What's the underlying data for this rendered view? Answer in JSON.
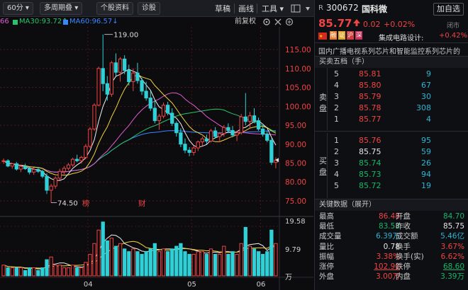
{
  "toolbar": {
    "period_select": "60分",
    "period_arrow": "▾",
    "multi_period": "多周期叠",
    "multi_period_arrow": "▾",
    "profile_button": "个股资料",
    "diagnose_button": "诊股",
    "draft_button": "草稿",
    "draw_button": "画线",
    "tools_button": "工具",
    "tools_arrow": "▾",
    "add_button": "加自选"
  },
  "ma_row": {
    "ma20": "66",
    "ma30": "MA30:93.72↑",
    "ma60": "MA60:96.57↓",
    "adjust_label": "前复权"
  },
  "stock": {
    "r_badge": "R",
    "code": "300672",
    "name": "国科微",
    "price": "85.77",
    "change": "0.02",
    "change_pct": "+0.02%",
    "sector_name": "集成电路设计:",
    "sector_pct": "+0.42%",
    "status": "闭市",
    "description": "国内广播电视系列芯片和智能监控系列芯片的",
    "badges": [
      "融",
      "证",
      "沪",
      "深"
    ]
  },
  "orderbook": {
    "title": "买卖五档（手）",
    "sell_label_1": "卖",
    "sell_label_2": "盘",
    "buy_label_1": "买",
    "buy_label_2": "盘",
    "asks": [
      {
        "level": "5",
        "price": "85.81",
        "vol": "9"
      },
      {
        "level": "4",
        "price": "85.80",
        "vol": "67"
      },
      {
        "level": "3",
        "price": "85.79",
        "vol": "30"
      },
      {
        "level": "2",
        "price": "85.78",
        "vol": "308"
      },
      {
        "level": "1",
        "price": "85.77",
        "vol": "4"
      }
    ],
    "bids": [
      {
        "level": "1",
        "price": "85.76",
        "vol": "95"
      },
      {
        "level": "2",
        "price": "85.75",
        "vol": "59"
      },
      {
        "level": "3",
        "price": "85.74",
        "vol": "26"
      },
      {
        "level": "4",
        "price": "85.73",
        "vol": "94"
      },
      {
        "level": "5",
        "price": "85.72",
        "vol": "19"
      }
    ]
  },
  "keydata": {
    "title": "关键数据（展开）",
    "rows": [
      {
        "k1": "最高",
        "v1": "86.48",
        "k2": "开盘",
        "v2": "84.70"
      },
      {
        "k1": "最低",
        "v1": "83.58",
        "k2": "昨收",
        "v2": "85.75"
      },
      {
        "k1": "成交量",
        "v1": "6.39万",
        "k2": "成交额",
        "v2": "5.46亿"
      },
      {
        "k1": "量比",
        "v1": "0.78",
        "k2": "换手",
        "v2": "3.67%"
      },
      {
        "k1": "振幅",
        "v1": "3.38%",
        "k2": "换手(实)",
        "v2": "6.62%"
      },
      {
        "k1": "涨停",
        "v1": "102.90",
        "k2": "跌停",
        "v2": "68.60"
      },
      {
        "k1": "外盘",
        "v1": "3.00万",
        "k2": "内盘",
        "v2": "3.39万"
      }
    ]
  },
  "chart_data": {
    "type": "candlestick",
    "price_axis": [
      "115.00",
      "110.00",
      "105.00",
      "100.00",
      "95.00",
      "90.00",
      "85.00",
      "80.00",
      "75.00"
    ],
    "volume_axis": [
      "19.58",
      "9.79",
      "万"
    ],
    "x_ticks": [
      "04",
      "05",
      "06"
    ],
    "high_label": "119.00",
    "low_label": "74.50",
    "markers": [
      "榜",
      "财"
    ],
    "ma_colors": {
      "ma5": "#f0f0f0",
      "ma10": "#f2d23a",
      "ma20": "#e05bd0",
      "ma30": "#27c36a",
      "ma60": "#3a86ff"
    },
    "candles": [
      [
        85.5,
        86.2,
        84.8,
        85.6
      ],
      [
        85.6,
        86.0,
        83.9,
        84.2
      ],
      [
        84.2,
        85.0,
        83.5,
        84.8
      ],
      [
        84.8,
        85.3,
        83.0,
        83.4
      ],
      [
        83.4,
        84.5,
        82.6,
        84.1
      ],
      [
        84.1,
        84.8,
        83.2,
        83.5
      ],
      [
        83.5,
        84.0,
        82.0,
        82.6
      ],
      [
        82.6,
        83.8,
        81.9,
        83.3
      ],
      [
        83.3,
        83.9,
        82.4,
        82.8
      ],
      [
        82.8,
        83.2,
        81.0,
        81.5
      ],
      [
        81.5,
        82.3,
        76.8,
        77.8
      ],
      [
        77.8,
        79.5,
        74.5,
        78.9
      ],
      [
        78.9,
        81.5,
        78.2,
        81.0
      ],
      [
        81.0,
        83.5,
        80.5,
        82.8
      ],
      [
        82.8,
        84.2,
        82.0,
        83.6
      ],
      [
        83.6,
        85.0,
        83.1,
        84.5
      ],
      [
        84.5,
        86.4,
        84.0,
        86.0
      ],
      [
        86.0,
        87.2,
        85.2,
        85.6
      ],
      [
        85.6,
        86.9,
        84.9,
        86.5
      ],
      [
        86.5,
        90.0,
        86.0,
        89.4
      ],
      [
        89.4,
        94.5,
        89.0,
        94.0
      ],
      [
        94.0,
        100.8,
        93.5,
        100.3
      ],
      [
        100.3,
        110.5,
        100.0,
        110.0
      ],
      [
        110.0,
        119.0,
        104.0,
        106.0
      ],
      [
        106.0,
        108.0,
        101.5,
        103.2
      ],
      [
        103.2,
        112.0,
        102.5,
        111.5
      ],
      [
        111.5,
        114.0,
        108.0,
        109.0
      ],
      [
        109.0,
        113.0,
        106.5,
        112.5
      ],
      [
        112.5,
        113.5,
        108.5,
        109.5
      ],
      [
        109.5,
        111.0,
        105.5,
        106.5
      ],
      [
        106.5,
        110.0,
        104.0,
        108.8
      ],
      [
        108.8,
        111.5,
        106.0,
        106.8
      ],
      [
        106.8,
        107.5,
        103.0,
        104.0
      ],
      [
        104.0,
        106.5,
        101.5,
        102.2
      ],
      [
        102.2,
        104.0,
        98.8,
        99.5
      ],
      [
        99.5,
        101.5,
        95.5,
        96.2
      ],
      [
        96.2,
        98.0,
        93.8,
        97.4
      ],
      [
        97.4,
        101.0,
        96.8,
        100.3
      ],
      [
        100.3,
        101.2,
        97.6,
        98.2
      ],
      [
        98.2,
        99.5,
        94.8,
        95.5
      ],
      [
        95.5,
        96.0,
        92.0,
        93.0
      ],
      [
        93.0,
        94.2,
        89.2,
        90.0
      ],
      [
        90.0,
        91.5,
        87.6,
        88.4
      ],
      [
        88.4,
        89.2,
        86.8,
        87.8
      ],
      [
        87.8,
        89.5,
        87.0,
        89.0
      ],
      [
        89.0,
        91.0,
        88.2,
        90.6
      ],
      [
        90.6,
        92.0,
        89.5,
        91.4
      ],
      [
        91.4,
        92.5,
        90.0,
        90.8
      ],
      [
        90.8,
        94.0,
        90.4,
        93.5
      ],
      [
        93.5,
        94.5,
        91.5,
        92.0
      ],
      [
        92.0,
        93.2,
        90.5,
        92.8
      ],
      [
        92.8,
        95.0,
        92.0,
        94.4
      ],
      [
        94.4,
        95.5,
        93.0,
        93.6
      ],
      [
        93.6,
        94.8,
        91.8,
        92.4
      ],
      [
        92.4,
        93.6,
        90.8,
        93.0
      ],
      [
        93.0,
        98.0,
        92.5,
        97.2
      ],
      [
        97.2,
        103.5,
        95.0,
        96.0
      ],
      [
        96.0,
        98.5,
        94.0,
        97.5
      ],
      [
        97.5,
        99.5,
        95.5,
        96.2
      ],
      [
        96.2,
        97.0,
        93.5,
        94.0
      ],
      [
        94.0,
        95.0,
        92.0,
        92.6
      ],
      [
        92.6,
        93.5,
        90.5,
        91.0
      ],
      [
        91.0,
        91.5,
        84.5,
        85.2
      ],
      [
        85.2,
        86.5,
        83.6,
        85.8
      ]
    ],
    "volumes": [
      4,
      3,
      3,
      3,
      3,
      2,
      3,
      3,
      2,
      3,
      6,
      7,
      4,
      4,
      3,
      3,
      4,
      3,
      3,
      5,
      8,
      12,
      17,
      20,
      13,
      14,
      11,
      12,
      10,
      9,
      10,
      9,
      8,
      9,
      10,
      12,
      9,
      10,
      9,
      10,
      11,
      12,
      9,
      8,
      8,
      9,
      9,
      8,
      10,
      8,
      8,
      11,
      8,
      9,
      8,
      12,
      18,
      11,
      10,
      9,
      8,
      9,
      17,
      12
    ]
  }
}
